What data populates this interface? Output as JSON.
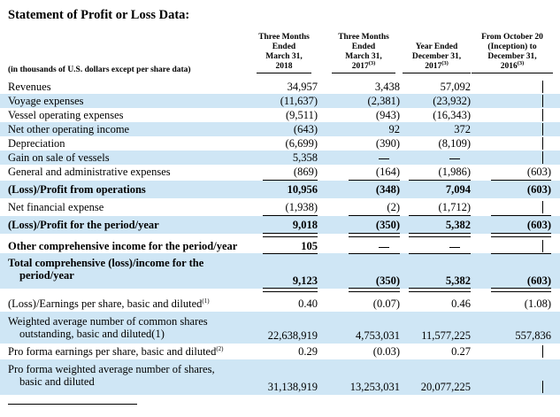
{
  "title": "Statement of Profit or Loss Data:",
  "units": "(in thousands of U.S. dollars except per share data)",
  "columns": [
    {
      "lines": [
        "Three Months",
        "Ended",
        "March 31,",
        "2018"
      ],
      "sup": ""
    },
    {
      "lines": [
        "Three Months",
        "Ended",
        "March 31,",
        "2017"
      ],
      "sup": "(3)"
    },
    {
      "lines": [
        "Year Ended",
        "December 31,",
        "2017"
      ],
      "sup": "(3)"
    },
    {
      "lines": [
        "From October 20",
        "(Inception) to",
        "December 31,",
        "2016"
      ],
      "sup": "(3)"
    }
  ],
  "rows": [
    {
      "label": "Revenues",
      "values": [
        "34,957",
        "3,438",
        "57,092",
        "—"
      ],
      "bold": false,
      "shade": false
    },
    {
      "label": "Voyage expenses",
      "values": [
        "(11,637)",
        "(2,381)",
        "(23,932)",
        "—"
      ],
      "bold": false,
      "shade": true
    },
    {
      "label": "Vessel operating expenses",
      "values": [
        "(9,511)",
        "(943)",
        "(16,343)",
        "—"
      ],
      "bold": false,
      "shade": false
    },
    {
      "label": "Net other operating income",
      "values": [
        "(643)",
        "92",
        "372",
        "—"
      ],
      "bold": false,
      "shade": true
    },
    {
      "label": "Depreciation",
      "values": [
        "(6,699)",
        "(390)",
        "(8,109)",
        "—"
      ],
      "bold": false,
      "shade": false
    },
    {
      "label": "Gain on sale of vessels",
      "values": [
        "5,358",
        "—",
        "—",
        "—"
      ],
      "bold": false,
      "shade": true
    },
    {
      "label": "General and administrative expenses",
      "values": [
        "(869)",
        "(164)",
        "(1,986)",
        "(603)"
      ],
      "bold": false,
      "shade": false
    },
    {
      "label": "(Loss)/Profit from operations",
      "values": [
        "10,956",
        "(348)",
        "7,094",
        "(603)"
      ],
      "bold": true,
      "shade": true
    },
    {
      "label": "Net financial expense",
      "values": [
        "(1,938)",
        "(2)",
        "(1,712)",
        "—"
      ],
      "bold": false,
      "shade": false
    },
    {
      "label": "(Loss)/Profit for the period/year",
      "values": [
        "9,018",
        "(350)",
        "5,382",
        "(603)"
      ],
      "bold": true,
      "shade": true
    },
    {
      "label": "Other comprehensive income for the period/year",
      "values": [
        "105",
        "—",
        "—",
        "—"
      ],
      "bold": true,
      "shade": false
    },
    {
      "label": "Total comprehensive (loss)/income for the",
      "label2": "period/year",
      "values": [
        "9,123",
        "(350)",
        "5,382",
        "(603)"
      ],
      "bold": true,
      "shade": true
    },
    {
      "label": "(Loss)/Earnings per share, basic and diluted",
      "sup": "(1)",
      "values": [
        "0.40",
        "(0.07)",
        "0.46",
        "(1.08)"
      ],
      "bold": false,
      "shade": false
    },
    {
      "label": "Weighted average number of common shares",
      "label2": "outstanding, basic and diluted(1)",
      "values": [
        "22,638,919",
        "4,753,031",
        "11,577,225",
        "557,836"
      ],
      "bold": false,
      "shade": true
    },
    {
      "label": "Pro forma earnings per share, basic and diluted",
      "sup": "(2)",
      "values": [
        "0.29",
        "(0.03)",
        "0.27",
        "—"
      ],
      "bold": false,
      "shade": false
    },
    {
      "label": "Pro forma weighted average number of shares,",
      "label2": "basic and diluted",
      "values": [
        "31,138,919",
        "13,253,031",
        "20,077,225",
        "—"
      ],
      "bold": false,
      "shade": true
    }
  ]
}
